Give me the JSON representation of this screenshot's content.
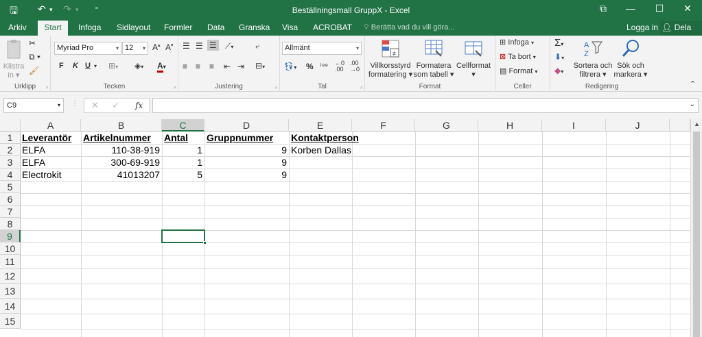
{
  "window": {
    "title": "Beställningsmall GruppX - Excel",
    "controls": {
      "restore": "⧉",
      "minimize": "—",
      "maximize": "☐",
      "close": "✕"
    }
  },
  "quick_access": {
    "save": "🖫",
    "undo": "↶",
    "undo_dd": "▾",
    "redo": "↷",
    "redo_dd": "▾",
    "customize": "⁼"
  },
  "ribbon_tabs": [
    "Arkiv",
    "Start",
    "Infoga",
    "Sidlayout",
    "Formler",
    "Data",
    "Granska",
    "Visa",
    "ACROBAT"
  ],
  "tell_me": "Berätta vad du vill göra...",
  "account": {
    "login": "Logga in",
    "share": "Dela"
  },
  "ribbon": {
    "clipboard": {
      "label": "Urklipp",
      "paste_line1": "Klistra",
      "paste_line2": "in"
    },
    "font": {
      "label": "Tecken",
      "name": "Myriad Pro",
      "size": "12",
      "bold": "F",
      "italic": "K",
      "underline": "U"
    },
    "alignment": {
      "label": "Justering"
    },
    "number": {
      "label": "Tal",
      "format": "Allmänt"
    },
    "styles": {
      "label": "Format",
      "conditional_line1": "Villkorsstyrd",
      "conditional_line2": "formatering",
      "table_line1": "Formatera",
      "table_line2": "som tabell",
      "cellstyle": "Cellformat"
    },
    "cells": {
      "label": "Celler",
      "insert": "Infoga",
      "delete": "Ta bort",
      "format": "Format"
    },
    "editing": {
      "label": "Redigering",
      "sort_line1": "Sortera och",
      "sort_line2": "filtrera",
      "find_line1": "Sök och",
      "find_line2": "markera"
    }
  },
  "formula_bar": {
    "name_box": "C9",
    "fx": "fx",
    "cancel": "✕",
    "enter": "✓",
    "value": ""
  },
  "columns": [
    "A",
    "B",
    "C",
    "D",
    "E",
    "F",
    "G",
    "H",
    "I",
    "J"
  ],
  "rows": [
    "1",
    "2",
    "3",
    "4",
    "5",
    "6",
    "7",
    "8",
    "9",
    "10",
    "11",
    "12",
    "13",
    "14",
    "15"
  ],
  "selected_cell": {
    "column": "C",
    "row": "9"
  },
  "sheet": {
    "headers": [
      "Leverantör",
      "Artikelnummer",
      "Antal",
      "Gruppnummer",
      "Kontaktperson"
    ],
    "data": [
      [
        "ELFA",
        "110-38-919",
        "1",
        "9",
        "Korben Dallas"
      ],
      [
        "ELFA",
        "300-69-919",
        "1",
        "9",
        ""
      ],
      [
        "Electrokit",
        "41013207",
        "5",
        "9",
        ""
      ]
    ]
  },
  "colors": {
    "accent": "#217346",
    "ribbon_bg": "#f3f3f3"
  }
}
